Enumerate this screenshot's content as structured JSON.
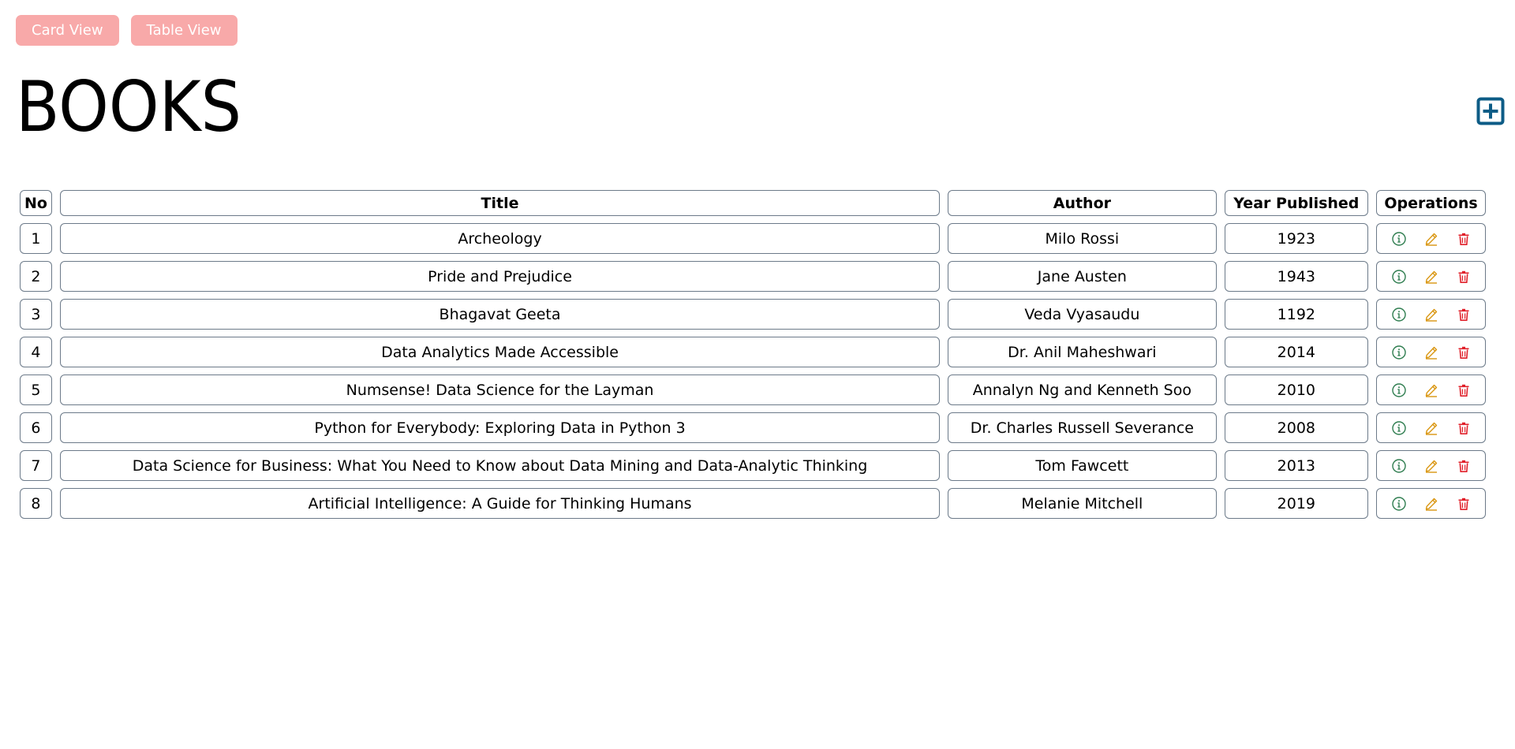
{
  "view_toggle": {
    "card_view_label": "Card View",
    "table_view_label": "Table View"
  },
  "page_title": "BOOKS",
  "colors": {
    "toggle_bg": "#f8a9a9",
    "add_icon": "#0d5c86",
    "info_icon": "#2e7d4f",
    "edit_icon": "#d9950f",
    "delete_icon": "#e0202a"
  },
  "table": {
    "headers": {
      "no": "No",
      "title": "Title",
      "author": "Author",
      "year": "Year Published",
      "operations": "Operations"
    },
    "rows": [
      {
        "no": "1",
        "title": "Archeology",
        "author": "Milo Rossi",
        "year": "1923"
      },
      {
        "no": "2",
        "title": "Pride and Prejudice",
        "author": "Jane Austen",
        "year": "1943"
      },
      {
        "no": "3",
        "title": "Bhagavat Geeta",
        "author": "Veda Vyasaudu",
        "year": "1192"
      },
      {
        "no": "4",
        "title": "Data Analytics Made Accessible",
        "author": "Dr. Anil Maheshwari",
        "year": "2014"
      },
      {
        "no": "5",
        "title": "Numsense! Data Science for the Layman",
        "author": "Annalyn Ng and Kenneth Soo",
        "year": "2010"
      },
      {
        "no": "6",
        "title": "Python for Everybody: Exploring Data in Python 3",
        "author": "Dr. Charles Russell Severance",
        "year": "2008"
      },
      {
        "no": "7",
        "title": "Data Science for Business: What You Need to Know about Data Mining and Data-Analytic Thinking",
        "author": "Tom Fawcett",
        "year": "2013"
      },
      {
        "no": "8",
        "title": "Artificial Intelligence: A Guide for Thinking Humans",
        "author": "Melanie Mitchell",
        "year": "2019"
      }
    ],
    "operation_icons": [
      "info-icon",
      "edit-icon",
      "delete-icon"
    ]
  }
}
